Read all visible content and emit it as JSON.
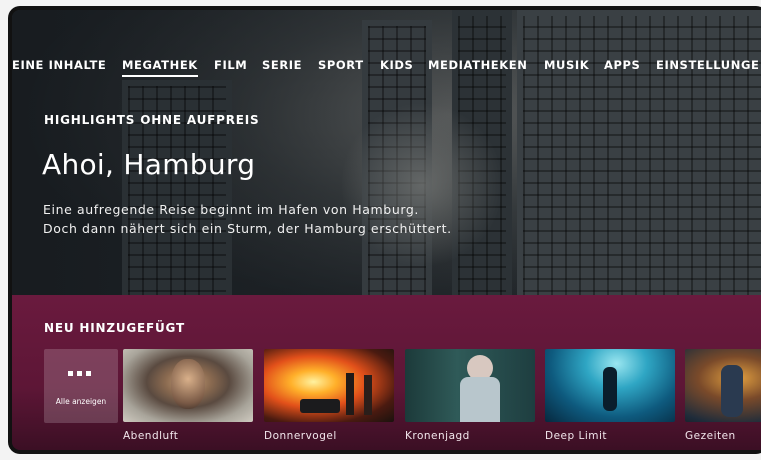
{
  "nav": {
    "items": [
      {
        "label": "EINE INHALTE",
        "active": false
      },
      {
        "label": "MEGATHEK",
        "active": true
      },
      {
        "label": "FILM",
        "active": false
      },
      {
        "label": "SERIE",
        "active": false
      },
      {
        "label": "SPORT",
        "active": false
      },
      {
        "label": "KIDS",
        "active": false
      },
      {
        "label": "MEDIATHEKEN",
        "active": false
      },
      {
        "label": "MUSIK",
        "active": false
      },
      {
        "label": "APPS",
        "active": false
      },
      {
        "label": "EINSTELLUNGE",
        "active": false
      }
    ]
  },
  "hero": {
    "eyebrow": "HIGHLIGHTS OHNE AUFPREIS",
    "title": "Ahoi, Hamburg",
    "description_lines": [
      "Eine aufregende Reise beginnt im Hafen von Hamburg.",
      "Doch dann nähert sich ein Sturm, der Hamburg erschüttert."
    ]
  },
  "row": {
    "title": "NEU HINZUGEFÜGT",
    "show_all_label": "Alle anzeigen",
    "cards": [
      {
        "title": "Abendluft",
        "icon": "portrait-thumbnail"
      },
      {
        "title": "Donnervogel",
        "icon": "explosion-thumbnail"
      },
      {
        "title": "Kronenjagd",
        "icon": "woman-forest-thumbnail"
      },
      {
        "title": "Deep Limit",
        "icon": "diver-thumbnail"
      },
      {
        "title": "Gezeiten",
        "icon": "figure-thumbnail"
      }
    ]
  },
  "colors": {
    "accent": "#6a1a3e",
    "text": "#ffffff"
  }
}
